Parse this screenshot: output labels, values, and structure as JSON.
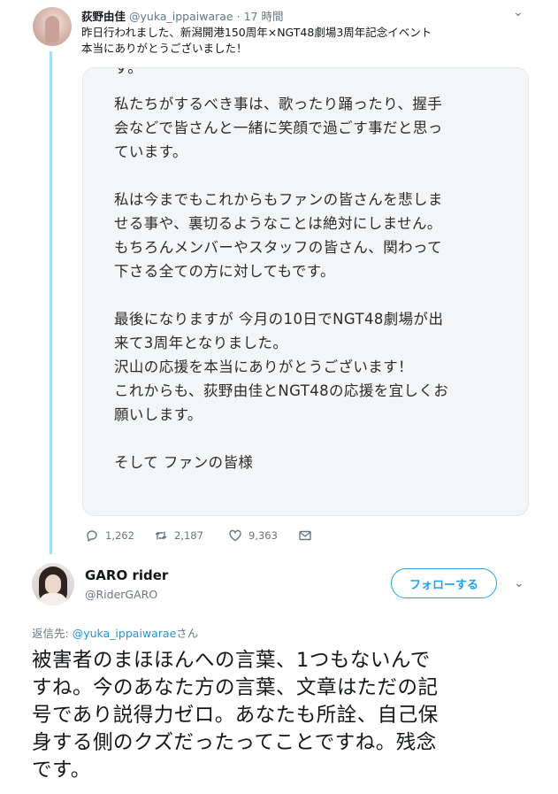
{
  "tweet1": {
    "display_name": "荻野由佳",
    "handle": "@yuka_ippaiwarae",
    "separator": "·",
    "time": "17 時間",
    "text_lines": [
      "昨日行われました、新潟開港150周年×NGT48劇場3周年記念イベント",
      "本当にありがとうございました！"
    ],
    "image_text": {
      "top_fragment": "す。",
      "paragraphs": [
        [
          "私たちがするべき事は、歌ったり踊ったり、握手",
          "会などで皆さんと一緒に笑顔で過ごす事だと思っ",
          "ています。"
        ],
        [
          "私は今までもこれからもファンの皆さんを悲しま",
          "せる事や、裏切るようなことは絶対にしません。",
          "もちろんメンバーやスタッフの皆さん、関わって",
          "下さる全ての方に対してもです。"
        ],
        [
          "最後になりますが 今月の10日でNGT48劇場が出",
          "来て3周年となりました。",
          "沢山の応援を本当にありがとうございます！",
          "これからも、荻野由佳とNGT48の応援を宜しくお",
          "願いします。"
        ]
      ],
      "bottom_fragment": "そして ファンの皆様"
    },
    "stats": {
      "replies": "1,262",
      "retweets": "2,187",
      "likes": "9,363"
    }
  },
  "tweet2": {
    "display_name": "GARO rider",
    "handle": "@RiderGARO",
    "follow_label": "フォローする",
    "reply_prefix": "返信先: ",
    "reply_mention": "@yuka_ippaiwarae",
    "reply_suffix": "さん",
    "text_lines": [
      "被害者のまほほんへの言葉、1つもないんで",
      "すね。今のあなた方の言葉、文章はただの記",
      "号であり説得力ゼロ。あなたも所詮、自己保",
      "身する側のクズだったってことですね。残念",
      "です。"
    ]
  },
  "icons": [
    "chevron-down-icon",
    "reply-icon",
    "retweet-icon",
    "like-icon",
    "message-icon"
  ],
  "colors": {
    "accent": "#1da1f2",
    "thread_line": "#a8dcf6",
    "muted": "#657786",
    "text": "#14171a",
    "card_bg": "#f4f5f7"
  }
}
